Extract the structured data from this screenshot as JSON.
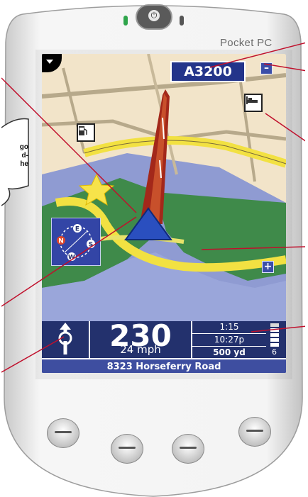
{
  "device": {
    "brand_label": "Pocket PC",
    "power_icon": "power-icon"
  },
  "screen": {
    "road_number": "A3200",
    "zoom_out_label": "–",
    "zoom_in_label": "+",
    "poi_icons": [
      "fuel-station-icon",
      "hotel-icon"
    ],
    "favourite_icon": "star-icon",
    "position_icon": "vehicle-arrow-icon",
    "compass_letters": [
      "N",
      "E",
      "S",
      "W"
    ]
  },
  "panel": {
    "next_turn_distance": "230",
    "speed": "24 mph",
    "remaining_time": "1:15",
    "arrival_time": "10:27p",
    "remaining_distance": "500 yd",
    "gps_signal_level": "6",
    "street_name": "8323 Horseferry Road"
  },
  "callout": {
    "lines": [
      "go",
      "d-",
      "he"
    ]
  },
  "colors": {
    "panel": "#23316d",
    "road_label": "#23348a",
    "route": "#a3281a",
    "callout_lines": "#c0102c"
  }
}
